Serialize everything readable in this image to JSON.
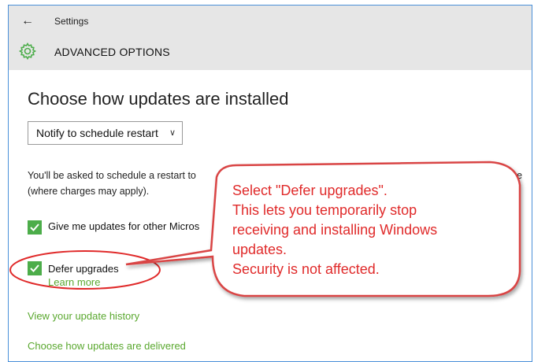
{
  "header": {
    "back_icon": "back-arrow-icon",
    "app_title": "Settings",
    "section_icon": "gear-icon",
    "section_title": "ADVANCED OPTIONS"
  },
  "main": {
    "heading": "Choose how updates are installed",
    "dropdown": {
      "selected": "Notify to schedule restart"
    },
    "description": {
      "line1": "You'll be asked to schedule a restart to",
      "line1_tail": "ere",
      "line2": "(where charges may apply)."
    },
    "options": [
      {
        "label": "Give me updates for other Micros",
        "checked": true
      },
      {
        "label": "Defer upgrades",
        "checked": true
      }
    ],
    "learn_more": "Learn more",
    "links": [
      "View your update history",
      "Choose how updates are delivered"
    ]
  },
  "callout": {
    "lines": [
      "Select \"Defer upgrades\".",
      "This lets you temporarily stop",
      "receiving and installing Windows",
      "updates.",
      "Security is not affected."
    ]
  },
  "colors": {
    "accent_green": "#4cad4a",
    "link_green": "#5aa82f",
    "annotation_red": "#e02a2a",
    "frame_blue": "#4a90d9",
    "header_gray": "#e6e6e6"
  }
}
